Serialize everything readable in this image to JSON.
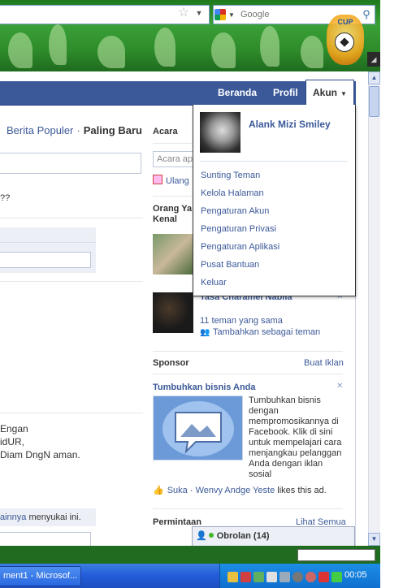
{
  "browser": {
    "search_placeholder": "Google",
    "star_icon": "star-icon",
    "search_icon": "magnifier-icon"
  },
  "theme": {
    "badge_text": "CUP"
  },
  "header": {
    "nav": [
      "Beranda",
      "Profil",
      "Akun"
    ],
    "accent": "#3b5998"
  },
  "feed": {
    "links": [
      "Berita Populer",
      "Paling Baru"
    ],
    "question_fragment": "??",
    "post_lines": [
      "Engan",
      "idUR,",
      "Diam DngN aman."
    ],
    "likes_link": "ainnya",
    "likes_text": " menyukai ini."
  },
  "events": {
    "title": "Acara",
    "input_placeholder": "Acara ap",
    "birthday": "Ulang"
  },
  "people": {
    "title": "Orang Ya Kenal",
    "friend_name": "Tasa Charamel Nabila",
    "mutual": "11 teman yang sama",
    "add": "Tambahkan sebagai teman"
  },
  "sponsor": {
    "title": "Sponsor",
    "create_ad": "Buat Iklan",
    "ad_title": "Tumbuhkan bisnis Anda",
    "ad_body": "Tumbuhkan bisnis dengan mempromosikannya di Facebook. Klik di sini untuk mempelajari cara menjangkau pelanggan Anda dengan iklan sosial",
    "like_label": "Suka",
    "liker": "Wenvy Andge Yeste",
    "like_suffix": " likes this ad."
  },
  "requests": {
    "title": "Permintaan",
    "see_all": "Lihat Semua"
  },
  "account_menu": {
    "user_name": "Alank Mizi Smiley",
    "items": [
      "Sunting Teman",
      "Kelola Halaman",
      "Pengaturan Akun",
      "Pengaturan Privasi",
      "Pengaturan Aplikasi",
      "Pusat Bantuan",
      "Keluar"
    ]
  },
  "chat": {
    "label": "Obrolan (14)"
  },
  "taskbar": {
    "task_label": "ment1 - Microsof...",
    "clock": "00:05"
  }
}
